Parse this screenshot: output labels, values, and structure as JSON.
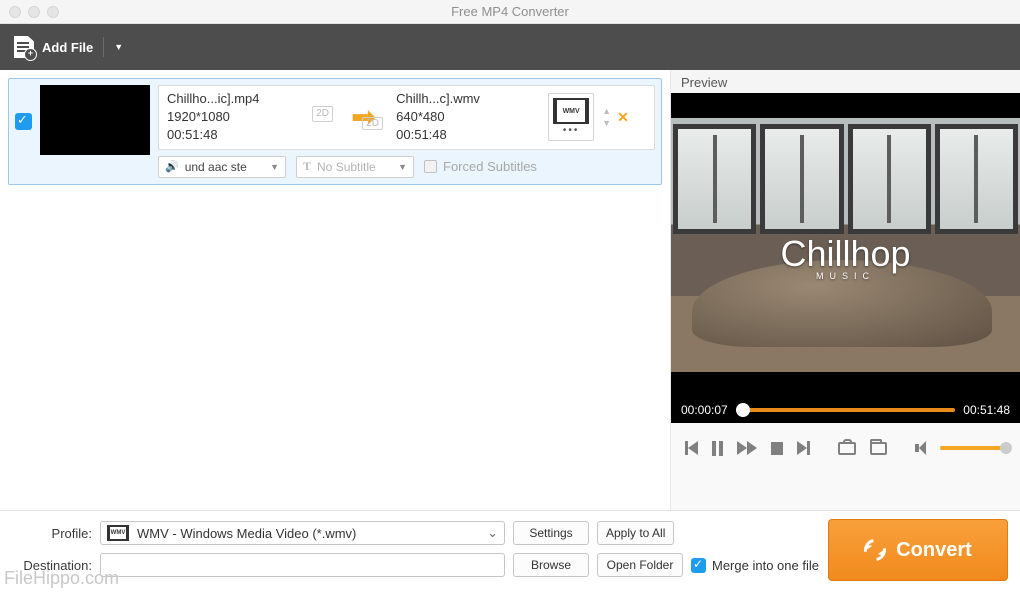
{
  "window": {
    "title": "Free MP4 Converter"
  },
  "toolbar": {
    "add_file": "Add File"
  },
  "item": {
    "src": {
      "name": "Chillho...ic].mp4",
      "dims": "1920*1080",
      "dur": "00:51:48",
      "badge": "2D"
    },
    "dst": {
      "name": "Chillh...c].wmv",
      "dims": "640*480",
      "dur": "00:51:48",
      "badge": "2D"
    },
    "fmt_label": "WMV",
    "audio_track": "und aac ste",
    "subtitle": "No Subtitle",
    "forced_subs": "Forced Subtitles"
  },
  "preview": {
    "label": "Preview",
    "logo": "Chillhop",
    "logo_sub": "MUSIC",
    "pos": "00:00:07",
    "dur": "00:51:48"
  },
  "bottom": {
    "profile_label": "Profile:",
    "profile_value": "WMV - Windows Media Video (*.wmv)",
    "settings": "Settings",
    "apply_all": "Apply to All",
    "dest_label": "Destination:",
    "browse": "Browse",
    "open_folder": "Open Folder",
    "merge": "Merge into one file",
    "convert": "Convert"
  },
  "watermark": "FileHippo.com"
}
